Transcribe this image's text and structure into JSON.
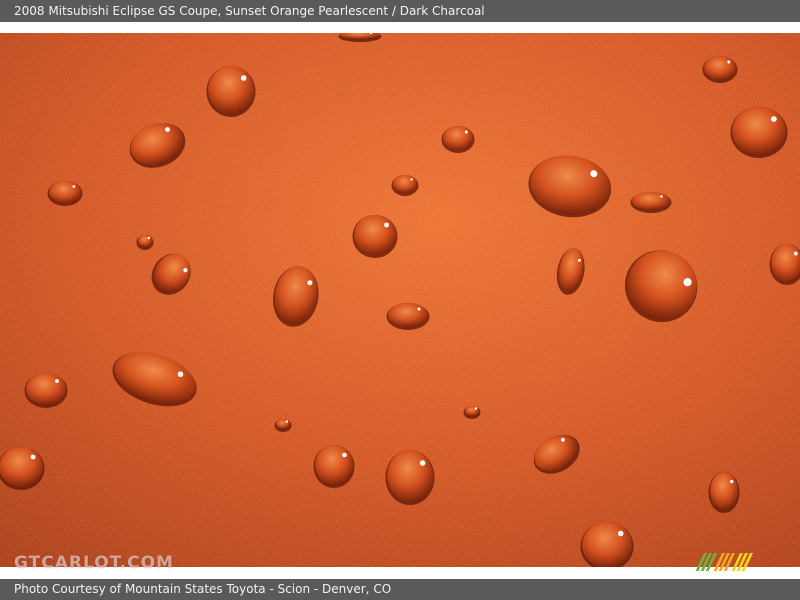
{
  "header": {
    "caption": "2008 Mitsubishi Eclipse GS Coupe,  Sunset Orange Pearlescent / Dark Charcoal"
  },
  "photo": {
    "subject": "water-droplets-on-orange-paint",
    "colors": {
      "paint_light": "#e8622a",
      "paint_mid": "#c9421a",
      "paint_dark": "#7c1f0a"
    }
  },
  "watermark": {
    "text": "GTCARLOT.COM"
  },
  "footer": {
    "credit": "Photo Courtesy of Mountain States Toyota - Scion - Denver, CO"
  },
  "logo": {
    "icon": "striped-logo-icon",
    "colors": [
      "#6db33f",
      "#f5a623",
      "#f7d21a"
    ]
  }
}
